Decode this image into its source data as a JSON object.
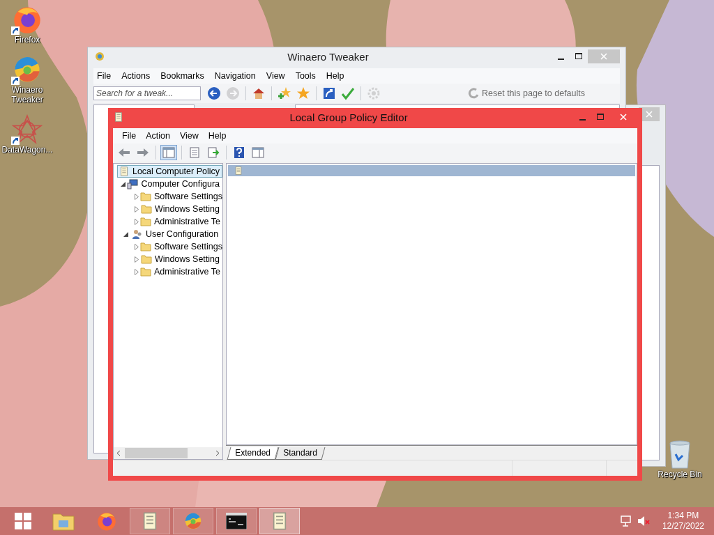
{
  "desktop_icons": [
    {
      "label": "Firefox",
      "kind": "firefox"
    },
    {
      "label": "Winaero Tweaker",
      "kind": "tweaker"
    },
    {
      "label": "DataWagon...",
      "kind": "datawagon"
    }
  ],
  "recycle_bin": {
    "label": "Recycle Bin"
  },
  "winaero_window": {
    "title": "Winaero Tweaker",
    "menu": [
      "File",
      "Actions",
      "Bookmarks",
      "Navigation",
      "View",
      "Tools",
      "Help"
    ],
    "search": {
      "placeholder": "Search for a tweak..."
    },
    "toolbar": [
      {
        "kind": "back",
        "disabled": false
      },
      {
        "kind": "forward",
        "disabled": true
      },
      {
        "kind": "home",
        "disabled": false
      },
      {
        "kind": "add-star",
        "disabled": false
      },
      {
        "kind": "star",
        "disabled": false
      },
      {
        "kind": "shortcut",
        "disabled": false
      },
      {
        "kind": "check",
        "disabled": false
      },
      {
        "kind": "gear",
        "disabled": true
      }
    ],
    "reset_label": "Reset this page to defaults"
  },
  "policy_window": {
    "title": "Local Group Policy Editor",
    "menu": [
      "File",
      "Action",
      "View",
      "Help"
    ],
    "toolbar": [
      {
        "kind": "back",
        "pressed": false
      },
      {
        "kind": "forward",
        "pressed": false
      },
      {
        "kind": "tree-toggle",
        "pressed": true
      },
      {
        "kind": "properties",
        "pressed": false
      },
      {
        "kind": "export",
        "pressed": false
      },
      {
        "kind": "help",
        "pressed": false
      },
      {
        "kind": "view",
        "pressed": false
      }
    ],
    "tree": [
      {
        "label": "Local Computer Policy",
        "kind": "policy",
        "selected": true,
        "children": [
          {
            "label": "Computer Configura",
            "kind": "computer",
            "selected": false,
            "expanded": true,
            "children": [
              {
                "label": "Software Settings",
                "kind": "folder",
                "selected": false,
                "expanded": false
              },
              {
                "label": "Windows Setting",
                "kind": "folder",
                "selected": false,
                "expanded": false
              },
              {
                "label": "Administrative Te",
                "kind": "folder",
                "selected": false,
                "expanded": false
              }
            ]
          },
          {
            "label": "User Configuration",
            "kind": "user",
            "selected": false,
            "expanded": true,
            "children": [
              {
                "label": "Software Settings",
                "kind": "folder",
                "selected": false,
                "expanded": false
              },
              {
                "label": "Windows Setting",
                "kind": "folder",
                "selected": false,
                "expanded": false
              },
              {
                "label": "Administrative Te",
                "kind": "folder",
                "selected": false,
                "expanded": false
              }
            ]
          }
        ]
      }
    ],
    "tabs": [
      {
        "label": "Extended",
        "selected": true
      },
      {
        "label": "Standard",
        "selected": false
      }
    ]
  },
  "taskbar": {
    "items": [
      {
        "kind": "explorer",
        "running": false,
        "selected": false
      },
      {
        "kind": "firefox",
        "running": false,
        "selected": false
      },
      {
        "kind": "policy",
        "running": true,
        "selected": false
      },
      {
        "kind": "tweaker",
        "running": true,
        "selected": false
      },
      {
        "kind": "console",
        "running": true,
        "selected": false
      },
      {
        "kind": "policy",
        "running": true,
        "selected": true
      }
    ],
    "clock": {
      "time": "1:34 PM",
      "date": "12/27/2022"
    }
  }
}
